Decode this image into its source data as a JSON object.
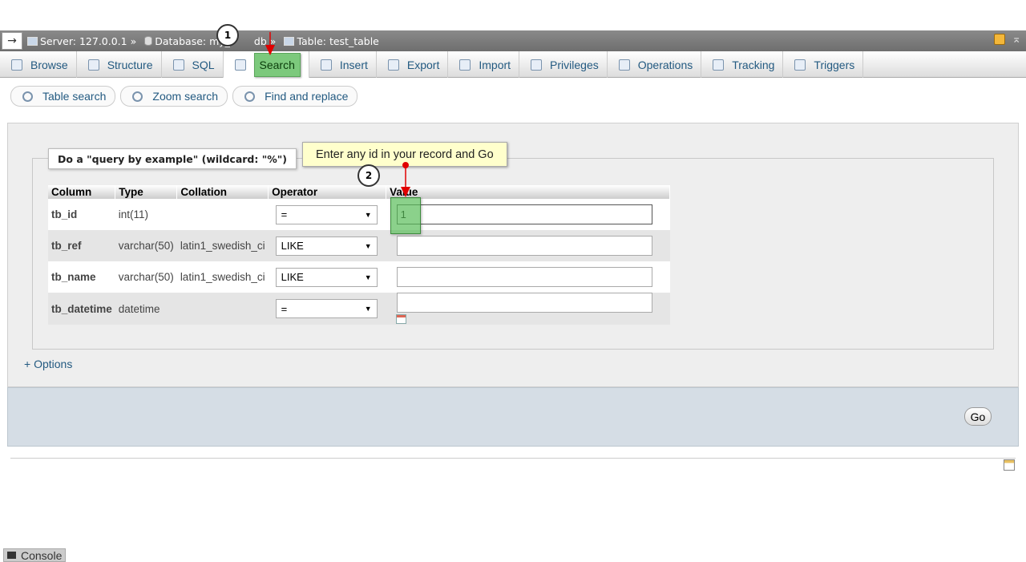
{
  "breadcrumb": {
    "arrow": "→",
    "server": "Server: 127.0.0.1",
    "database": "Database: my_",
    "database_tail": "db",
    "table": "Table: test_table",
    "separator": "»"
  },
  "tabs": [
    {
      "label": "Browse",
      "icon": "browse-icon"
    },
    {
      "label": "Structure",
      "icon": "structure-icon"
    },
    {
      "label": "SQL",
      "icon": "sql-icon"
    },
    {
      "label": "Search",
      "icon": "search-icon",
      "active": true
    },
    {
      "label": "Insert",
      "icon": "insert-icon"
    },
    {
      "label": "Export",
      "icon": "export-icon"
    },
    {
      "label": "Import",
      "icon": "import-icon"
    },
    {
      "label": "Privileges",
      "icon": "privileges-icon"
    },
    {
      "label": "Operations",
      "icon": "operations-icon"
    },
    {
      "label": "Tracking",
      "icon": "tracking-icon"
    },
    {
      "label": "Triggers",
      "icon": "triggers-icon"
    }
  ],
  "subtabs": [
    {
      "label": "Table search",
      "icon": "magnifier-icon"
    },
    {
      "label": "Zoom search",
      "icon": "zoom-icon"
    },
    {
      "label": "Find and replace",
      "icon": "replace-icon"
    }
  ],
  "form": {
    "legend": "Do a \"query by example\" (wildcard: \"%\")",
    "headers": {
      "column": "Column",
      "type": "Type",
      "collation": "Collation",
      "operator": "Operator",
      "value": "Value"
    },
    "rows": [
      {
        "column": "tb_id",
        "type": "int(11)",
        "collation": "",
        "operator": "=",
        "value": "1"
      },
      {
        "column": "tb_ref",
        "type": "varchar(50)",
        "collation": "latin1_swedish_ci",
        "operator": "LIKE",
        "value": ""
      },
      {
        "column": "tb_name",
        "type": "varchar(50)",
        "collation": "latin1_swedish_ci",
        "operator": "LIKE",
        "value": ""
      },
      {
        "column": "tb_datetime",
        "type": "datetime",
        "collation": "",
        "operator": "=",
        "value": ""
      }
    ],
    "options_link": "+ Options",
    "go_label": "Go"
  },
  "console_label": "Console",
  "annotations": {
    "tooltip": "Enter any id in your record and Go",
    "step1": "1",
    "step2": "2",
    "highlight_color": "#7cc97c",
    "arrow_color": "#e00000"
  }
}
